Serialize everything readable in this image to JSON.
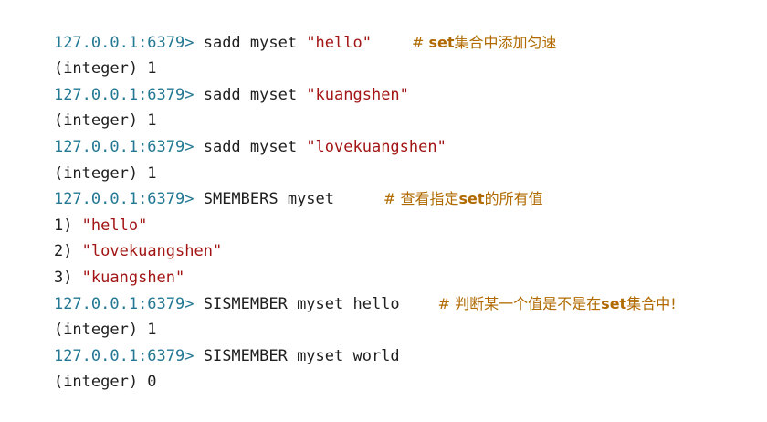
{
  "colors": {
    "prompt": "#237893",
    "string": "#a31515",
    "comment": "#b06a00",
    "text": "#1f1f1f",
    "background": "#ffffff"
  },
  "lines": [
    {
      "prompt": "127.0.0.1:6379>",
      "cmd": " sadd myset ",
      "str": "\"hello\"",
      "comment_hash": "# ",
      "comment_kw": "set",
      "comment_rest": "集合中添加匀速"
    },
    {
      "output": "(integer) 1"
    },
    {
      "prompt": "127.0.0.1:6379>",
      "cmd": " sadd myset ",
      "str": "\"kuangshen\""
    },
    {
      "output": "(integer) 1"
    },
    {
      "prompt": "127.0.0.1:6379>",
      "cmd": " sadd myset ",
      "str": "\"lovekuangshen\""
    },
    {
      "output": "(integer) 1"
    },
    {
      "prompt": "127.0.0.1:6379>",
      "cmd": " SMEMBERS myset",
      "comment_hash": "# ",
      "comment_pre": "查看指定",
      "comment_kw": "set",
      "comment_rest": "的所有值"
    },
    {
      "idx": "1) ",
      "str": "\"hello\""
    },
    {
      "idx": "2) ",
      "str": "\"lovekuangshen\""
    },
    {
      "idx": "3) ",
      "str": "\"kuangshen\""
    },
    {
      "prompt": "127.0.0.1:6379>",
      "cmd": " SISMEMBER myset hello",
      "comment_hash": "# ",
      "comment_pre": "判断某一个值是不是在",
      "comment_kw": "set",
      "comment_rest": "集合中!"
    },
    {
      "output": "(integer) 1"
    },
    {
      "prompt": "127.0.0.1:6379>",
      "cmd": " SISMEMBER myset world"
    },
    {
      "output": "(integer) 0"
    }
  ]
}
